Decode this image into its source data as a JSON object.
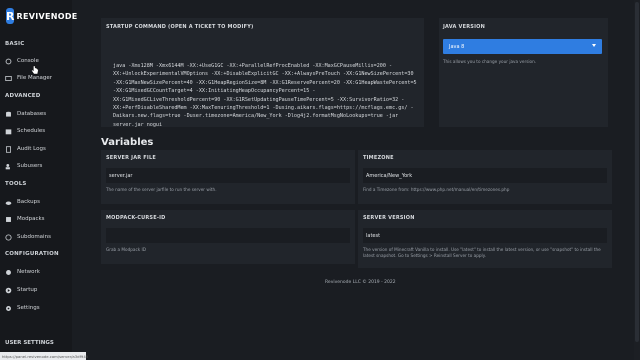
{
  "brand": {
    "mark": "R",
    "name": "REVIVENODE"
  },
  "sidebar": {
    "sections": [
      {
        "label": "BASIC",
        "items": [
          {
            "label": "Console",
            "icon": "circle-icon"
          },
          {
            "label": "File Manager",
            "icon": "folder-icon"
          }
        ]
      },
      {
        "label": "ADVANCED",
        "items": [
          {
            "label": "Databases",
            "icon": "database-icon"
          },
          {
            "label": "Schedules",
            "icon": "calendar-icon"
          },
          {
            "label": "Audit Logs",
            "icon": "document-icon"
          },
          {
            "label": "Subusers",
            "icon": "users-icon"
          }
        ]
      },
      {
        "label": "TOOLS",
        "items": [
          {
            "label": "Backups",
            "icon": "cloud-icon"
          },
          {
            "label": "Modpacks",
            "icon": "box-icon"
          },
          {
            "label": "Subdomains",
            "icon": "globe-icon"
          }
        ]
      },
      {
        "label": "CONFIGURATION",
        "items": [
          {
            "label": "Network",
            "icon": "network-icon"
          },
          {
            "label": "Startup",
            "icon": "play-icon"
          },
          {
            "label": "Settings",
            "icon": "gear-icon"
          }
        ]
      }
    ],
    "user_settings": "USER SETTINGS"
  },
  "startup": {
    "title": "STARTUP COMMAND (OPEN A TICKET TO MODIFY)",
    "command": "java -Xms128M -Xmx6144M -XX:+UseG1GC -XX:+ParallelRefProcEnabled -XX:MaxGCPauseMillis=200 -XX:+UnlockExperimentalVMOptions -XX:+DisableExplicitGC -XX:+AlwaysPreTouch -XX:G1NewSizePercent=30 -XX:G1MaxNewSizePercent=40 -XX:G1HeapRegionSize=8M -XX:G1ReservePercent=20 -XX:G1HeapWastePercent=5 -XX:G1MixedGCCountTarget=4 -XX:InitiatingHeapOccupancyPercent=15 -XX:G1MixedGCLiveThresholdPercent=90 -XX:G1RSetUpdatingPauseTimePercent=5 -XX:SurvivorRatio=32 -XX:+PerfDisableSharedMem -XX:MaxTenuringThreshold=1 -Dusing.aikars.flags=https://mcflags.emc.gs/ -Daikars.new.flags=true -Duser.timezone=America/New_York -Dlog4j2.formatMsgNoLookups=true -jar server.jar nogui"
  },
  "java": {
    "title": "JAVA VERSION",
    "selected": "Java 8",
    "help": "This allows you to change your java version."
  },
  "variables": {
    "title": "Variables",
    "items": [
      {
        "name": "SERVER JAR FILE",
        "value": "server.jar",
        "desc": "The name of the server jarfile to run the server with."
      },
      {
        "name": "TIMEZONE",
        "value": "America/New_York",
        "desc": "Find a Timezone from: https://www.php.net/manual/en/timezones.php"
      },
      {
        "name": "MODPACK-CURSE-ID",
        "value": "",
        "desc": "Grab a Modpack ID"
      },
      {
        "name": "SERVER VERSION",
        "value": "latest",
        "desc": "The version of Minecraft Vanilla to install. Use \"latest\" to install the latest version, or use \"snapshot\" to install the latest snapshot. Go to Settings > Reinstall Server to apply."
      }
    ]
  },
  "footer": "Revivenode LLC © 2019 - 2022",
  "status_url": "https://panel.revivenode.com/server/a3df945"
}
